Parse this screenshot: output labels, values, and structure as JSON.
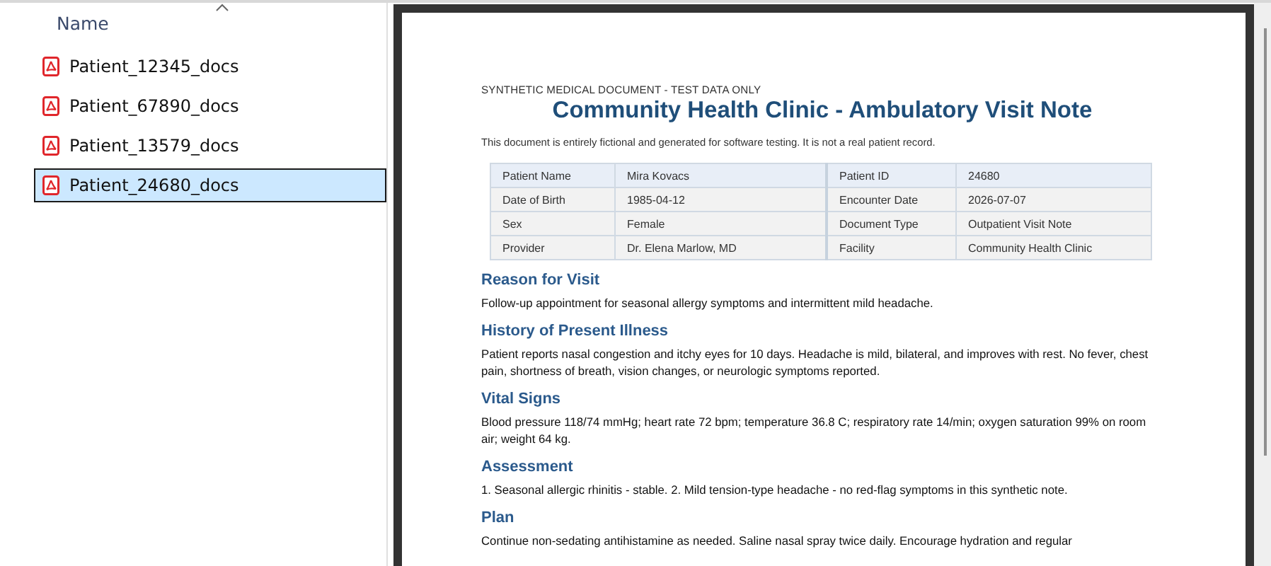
{
  "file_list": {
    "column_header": "Name",
    "files": [
      {
        "name": "Patient_12345_docs",
        "selected": false
      },
      {
        "name": "Patient_67890_docs",
        "selected": false
      },
      {
        "name": "Patient_13579_docs",
        "selected": false
      },
      {
        "name": "Patient_24680_docs",
        "selected": true
      }
    ]
  },
  "document": {
    "banner": "SYNTHETIC MEDICAL DOCUMENT - TEST DATA ONLY",
    "title": "Community Health Clinic - Ambulatory Visit Note",
    "disclaimer": "This document is entirely fictional and generated for software testing. It is not a real patient record.",
    "info_table": [
      [
        "Patient Name",
        "Mira Kovacs",
        "Patient ID",
        "24680"
      ],
      [
        "Date of Birth",
        "1985-04-12",
        "Encounter Date",
        "2026-07-07"
      ],
      [
        "Sex",
        "Female",
        "Document Type",
        "Outpatient Visit Note"
      ],
      [
        "Provider",
        "Dr. Elena Marlow, MD",
        "Facility",
        "Community Health Clinic"
      ]
    ],
    "sections": [
      {
        "heading": "Reason for Visit",
        "body": "Follow-up appointment for seasonal allergy symptoms and  intermittent mild headache."
      },
      {
        "heading": "History of Present Illness",
        "body": "Patient reports nasal congestion and itchy eyes for 10 days. Headache is mild, bilateral, and improves with rest. No fever, chest pain, shortness of breath, vision changes, or neurologic symptoms reported."
      },
      {
        "heading": "Vital Signs",
        "body": "Blood pressure 118/74 mmHg; heart rate 72 bpm; temperature 36.8 C; respiratory rate 14/min; oxygen saturation 99% on room air; weight 64 kg."
      },
      {
        "heading": "Assessment",
        "body": "1. Seasonal allergic rhinitis - stable. 2. Mild tension-type headache - no red-flag symptoms in this synthetic note."
      },
      {
        "heading": "Plan",
        "body": "Continue non-sedating antihistamine as needed. Saline nasal spray twice daily. Encourage hydration and regular"
      }
    ]
  }
}
